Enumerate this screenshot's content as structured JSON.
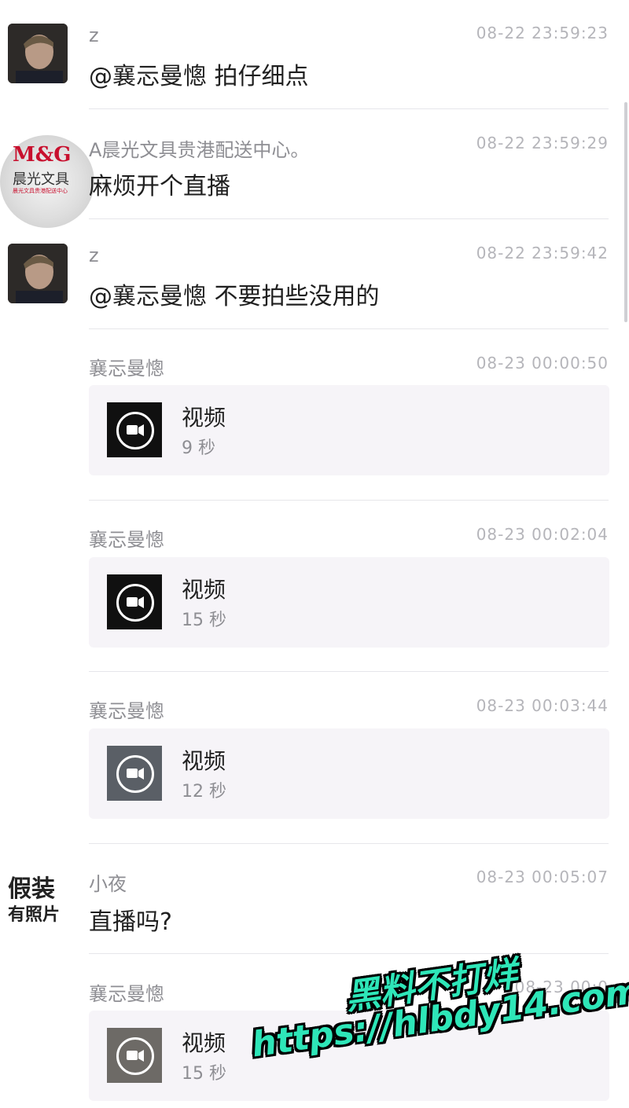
{
  "messages": [
    {
      "sender": "z",
      "time": "08-22 23:59:23",
      "text": "@襄忈曼憁 拍仔细点",
      "avatar": "portrait-photo"
    },
    {
      "sender": "A晨光文具贵港配送中心。",
      "time": "08-22 23:59:29",
      "text": "麻烦开个直播",
      "avatar": "mg-logo"
    },
    {
      "sender": "z",
      "time": "08-22 23:59:42",
      "text": "@襄忈曼憁 不要拍些没用的",
      "avatar": "portrait-photo"
    },
    {
      "sender": "襄忈曼憁",
      "time": "08-23 00:00:50",
      "video": {
        "title": "视频",
        "duration": "9 秒"
      }
    },
    {
      "sender": "襄忈曼憁",
      "time": "08-23 00:02:04",
      "video": {
        "title": "视频",
        "duration": "15 秒"
      }
    },
    {
      "sender": "襄忈曼憁",
      "time": "08-23 00:03:44",
      "video": {
        "title": "视频",
        "duration": "12 秒"
      }
    },
    {
      "sender": "小夜",
      "time": "08-23 00:05:07",
      "text": "直播吗?",
      "avatar": "calligraphy"
    },
    {
      "sender": "襄忈曼憁",
      "time": "08-23 00:0",
      "video": {
        "title": "视频",
        "duration": "15 秒"
      }
    }
  ],
  "avatars": {
    "mg_logo": {
      "brand": "M&G",
      "name": "晨光文具",
      "tagline": "晨光文具贵港配送中心"
    },
    "calligraphy": {
      "line1": "假装",
      "line2": "有照片"
    }
  },
  "watermark": {
    "line1": "黑料不打烊",
    "line2": "https://hlbdy14.com",
    "color": "#2ee6b8"
  },
  "icons": {
    "video": "video-camera-icon"
  }
}
